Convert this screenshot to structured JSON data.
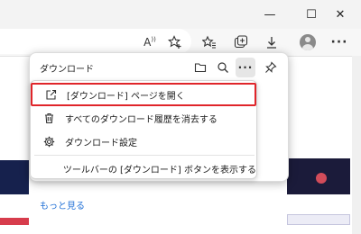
{
  "window": {
    "minimize_symbol": "—",
    "maximize_symbol": "☐",
    "close_symbol": "✕"
  },
  "toolbar": {
    "read_aloud_label": "A",
    "icons": [
      "read-aloud-icon",
      "add-favorite-icon",
      "favorites-icon",
      "collections-icon",
      "download-icon",
      "profile-icon",
      "more-options-icon"
    ]
  },
  "downloads": {
    "title": "ダウンロード",
    "menu": {
      "items": [
        {
          "label": "[ダウンロード] ページを開く",
          "icon": "open-external-icon",
          "highlighted": true
        },
        {
          "label": "すべてのダウンロード履歴を消去する",
          "icon": "trash-icon",
          "highlighted": false
        },
        {
          "label": "ダウンロード設定",
          "icon": "gear-icon",
          "highlighted": false
        },
        {
          "label": "ツールバーの [ダウンロード] ボタンを表示する",
          "icon": "",
          "highlighted": false
        }
      ]
    }
  },
  "page": {
    "see_more_link": "もっと見る"
  },
  "colors": {
    "highlight_border": "#e0252a",
    "link": "#1f6fd6"
  }
}
